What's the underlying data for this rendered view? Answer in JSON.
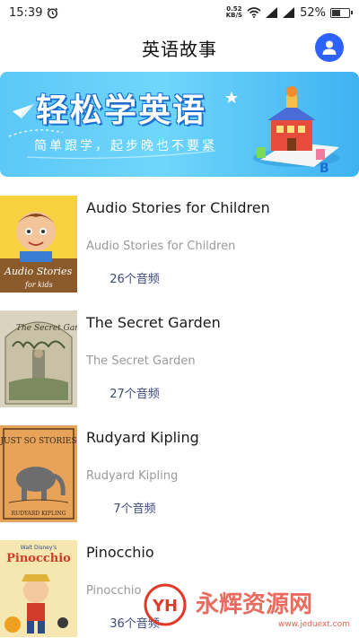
{
  "status_bar": {
    "time": "15:39",
    "net_speed_value": "0.52",
    "net_speed_unit": "KB/S",
    "battery": "52%",
    "battery_level": 0.52,
    "icons": [
      "alarm-icon",
      "wifi-icon",
      "signal-icon",
      "signal-icon",
      "battery-icon"
    ]
  },
  "app_bar": {
    "title": "英语故事",
    "icons": [
      "user-avatar-icon"
    ]
  },
  "banner": {
    "title": "轻松学英语",
    "subtitle": "简单跟学，起步晚也不要紧",
    "colors": {
      "start": "#5cc8f7",
      "end": "#3fb2f1",
      "title_outline": "#1a6fd0"
    }
  },
  "books": [
    {
      "title": "Audio Stories for Children",
      "subtitle": "Audio Stories for Children",
      "count": "26个音频",
      "cover_text": "Audio Stories",
      "cover_text2": "for kids"
    },
    {
      "title": "The Secret Garden",
      "subtitle": "The Secret Garden",
      "count": "27个音频",
      "cover_text": "The Secret Garden",
      "cover_text2": ""
    },
    {
      "title": "Rudyard Kipling",
      "subtitle": "Rudyard Kipling",
      "count": "7个音频",
      "cover_text": "JUST SO STORIES",
      "cover_text2": "RUDYARD KIPLING"
    },
    {
      "title": "Pinocchio",
      "subtitle": "Pinocchio",
      "count": "36个音频",
      "cover_text": "Pinocchio",
      "cover_text2": "Walt Disney's"
    }
  ],
  "watermark": {
    "logo_text": "YH",
    "text": "永辉资源网",
    "url": "www.jeduext.com"
  }
}
